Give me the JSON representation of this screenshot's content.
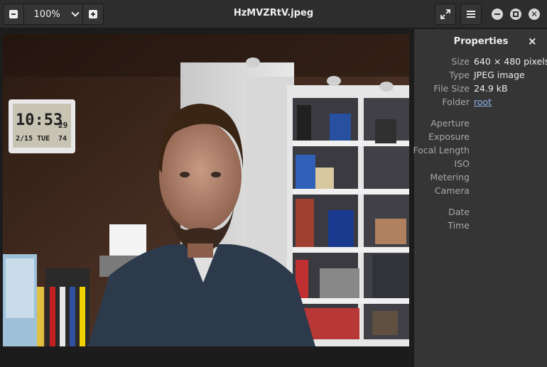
{
  "window": {
    "title": "HzMVZRtV.jpeg"
  },
  "toolbar": {
    "zoom_value": "100%",
    "zoom_out_icon": "zoom-out-icon",
    "zoom_in_icon": "zoom-in-icon",
    "fullscreen_icon": "fullscreen-icon",
    "menu_icon": "hamburger-menu-icon"
  },
  "image": {
    "description_icon": "photo-webcam-portrait"
  },
  "properties": {
    "title": "Properties",
    "close_label": "×",
    "rows": [
      {
        "key": "Size",
        "value": "640 × 480 pixels"
      },
      {
        "key": "Type",
        "value": "JPEG image"
      },
      {
        "key": "File Size",
        "value": "24.9 kB"
      },
      {
        "key": "Folder",
        "value": "root"
      },
      {
        "key": "Aperture",
        "value": ""
      },
      {
        "key": "Exposure",
        "value": ""
      },
      {
        "key": "Focal Length",
        "value": ""
      },
      {
        "key": "ISO",
        "value": ""
      },
      {
        "key": "Metering",
        "value": ""
      },
      {
        "key": "Camera",
        "value": ""
      },
      {
        "key": "Date",
        "value": ""
      },
      {
        "key": "Time",
        "value": ""
      }
    ]
  },
  "clock": {
    "time": "10:53",
    "seconds": "29",
    "date_line": "2/15 TUE",
    "temp": "74"
  },
  "colors": {
    "headerbar": "#2d2d2d",
    "sidebar": "#353535",
    "link": "#8cb4e8"
  }
}
